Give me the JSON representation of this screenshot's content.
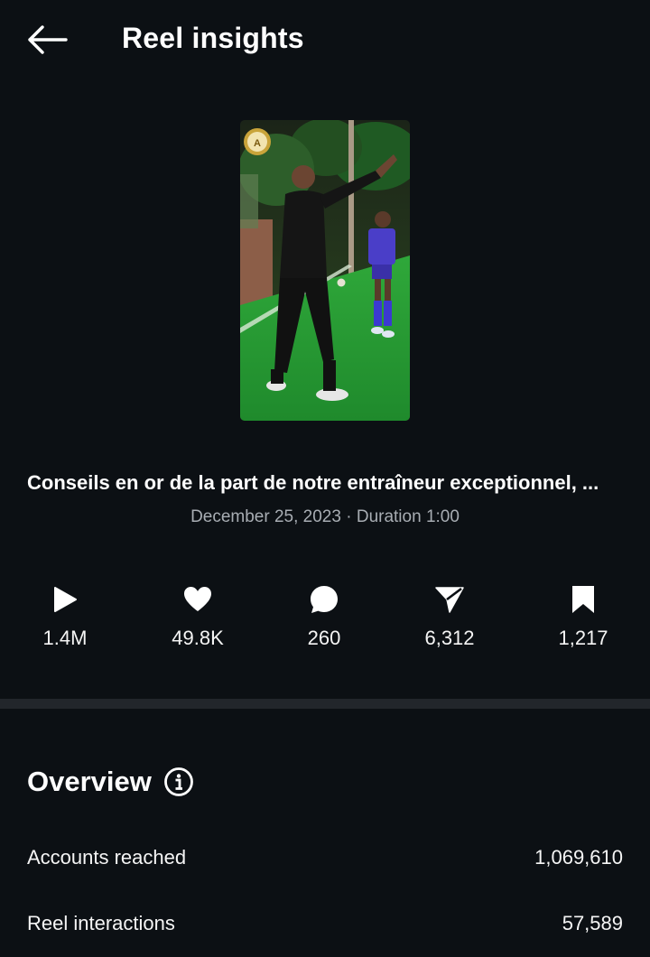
{
  "header": {
    "title": "Reel insights",
    "back_icon": "arrow-left-icon"
  },
  "reel": {
    "caption": "Conseils en or de la part de notre entraîneur exceptionnel, ...",
    "date": "December 25, 2023",
    "separator": "·",
    "duration": "Duration 1:00"
  },
  "stats": [
    {
      "icon": "play-icon",
      "value": "1.4M"
    },
    {
      "icon": "heart-icon",
      "value": "49.8K"
    },
    {
      "icon": "comment-icon",
      "value": "260"
    },
    {
      "icon": "share-icon",
      "value": "6,312"
    },
    {
      "icon": "bookmark-icon",
      "value": "1,217"
    }
  ],
  "overview": {
    "title": "Overview",
    "rows": [
      {
        "label": "Accounts reached",
        "value": "1,069,610"
      },
      {
        "label": "Reel interactions",
        "value": "57,589"
      }
    ]
  },
  "colors": {
    "background": "#0c1014",
    "secondary_text": "#a8adb3",
    "divider": "#22262b"
  }
}
